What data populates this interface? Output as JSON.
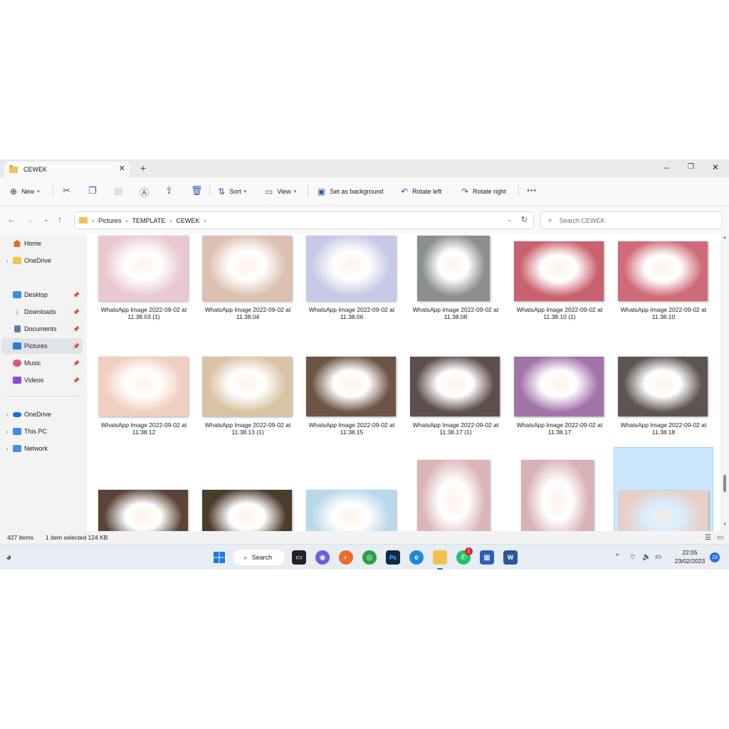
{
  "window": {
    "tab_title": "CEWEK",
    "new_tab": "+",
    "close_tab": "✕"
  },
  "toolbar": {
    "new_label": "New",
    "sort_label": "Sort",
    "view_label": "View",
    "set_background_label": "Set as background",
    "rotate_left_label": "Rotate left",
    "rotate_right_label": "Rotate right",
    "more_label": "···"
  },
  "breadcrumb": [
    "Pictures",
    "TEMPLATE",
    "CEWEK"
  ],
  "search": {
    "placeholder": "Search CEWEK"
  },
  "sidebar": {
    "items": [
      {
        "label": "Home"
      },
      {
        "label": "OneDrive"
      },
      {
        "label": "Desktop"
      },
      {
        "label": "Downloads"
      },
      {
        "label": "Documents"
      },
      {
        "label": "Pictures"
      },
      {
        "label": "Music"
      },
      {
        "label": "Videos"
      },
      {
        "label": "OneDrive"
      },
      {
        "label": "This PC"
      },
      {
        "label": "Network"
      }
    ]
  },
  "files": [
    {
      "line1": "WhatsApp Image 2022-09-02 at",
      "line2": "11.38.03 (1)",
      "color": "#e9c9cf"
    },
    {
      "line1": "WhatsApp Image 2022-09-02 at",
      "line2": "11.38.04",
      "color": "#dcc0b0"
    },
    {
      "line1": "WhatsApp Image 2022-09-02 at",
      "line2": "11.38.06",
      "color": "#c6c9e6"
    },
    {
      "line1": "WhatsApp Image 2022-09-02 at",
      "line2": "11.38.08",
      "color": "#8b8f8f"
    },
    {
      "line1": "WhatsApp Image 2022-09-02 at",
      "line2": "11.38.10 (1)",
      "color": "#c9616e"
    },
    {
      "line1": "WhatsApp Image 2022-09-02 at",
      "line2": "11.38.10",
      "color": "#cf6b79"
    },
    {
      "line1": "WhatsApp Image 2022-09-02 at",
      "line2": "11.38.12",
      "color": "#f1cfc0"
    },
    {
      "line1": "WhatsApp Image 2022-09-02 at",
      "line2": "11.38.13 (1)",
      "color": "#d9c3a4"
    },
    {
      "line1": "WhatsApp Image 2022-09-02 at",
      "line2": "11.38.15",
      "color": "#6e5444"
    },
    {
      "line1": "WhatsApp Image 2022-09-02 at",
      "line2": "11.38.17 (1)",
      "color": "#5f4f4c"
    },
    {
      "line1": "WhatsApp Image 2022-09-02 at",
      "line2": "11.38.17",
      "color": "#a173a8"
    },
    {
      "line1": "WhatsApp Image 2022-09-02 at",
      "line2": "11.38.18",
      "color": "#5e5451"
    },
    {
      "line1": "",
      "line2": "",
      "color": "#5a4437"
    },
    {
      "line1": "",
      "line2": "",
      "color": "#4d3b2c"
    },
    {
      "line1": "",
      "line2": "",
      "color": "#b9d8ea"
    },
    {
      "line1": "",
      "line2": "",
      "color": "#dcb6b6"
    },
    {
      "line1": "",
      "line2": "",
      "color": "#d8b1b4"
    },
    {
      "line1": "",
      "line2": "",
      "color": "#e7cfc6"
    }
  ],
  "status": {
    "item_count": "427 items",
    "selection": "1 item selected  124 KB"
  },
  "taskbar": {
    "search_label": "Search",
    "time": "22:05",
    "date": "23/02/2023",
    "notification_count": "23",
    "whatsapp_badge": "1"
  },
  "colors": {
    "accent": "#2b6de0",
    "selection_bg": "#cce8ff",
    "folder": "#f2c14e"
  }
}
